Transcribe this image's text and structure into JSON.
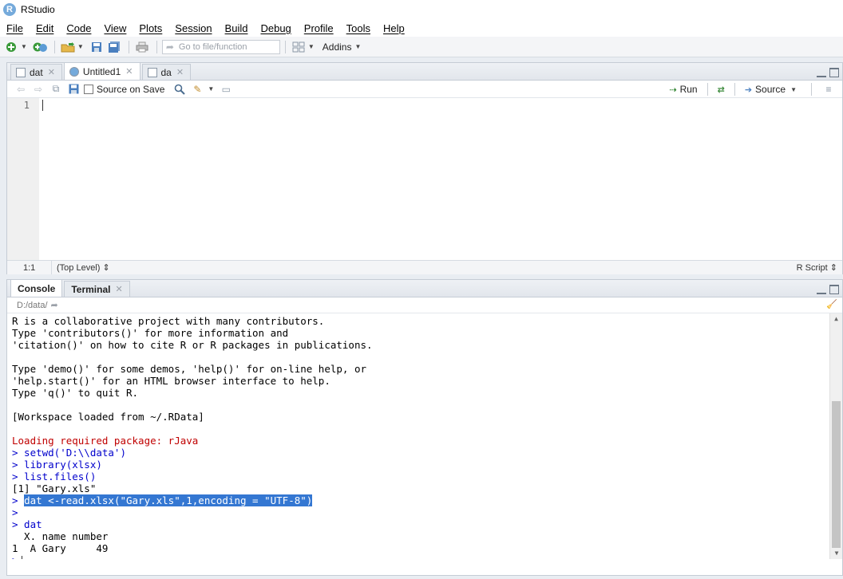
{
  "app": {
    "title": "RStudio",
    "logo": "R"
  },
  "menu": [
    "File",
    "Edit",
    "Code",
    "View",
    "Plots",
    "Session",
    "Build",
    "Debug",
    "Profile",
    "Tools",
    "Help"
  ],
  "toolbar": {
    "goto_placeholder": "Go to file/function",
    "addins_label": "Addins"
  },
  "source": {
    "tabs": [
      {
        "label": "dat",
        "active": false
      },
      {
        "label": "Untitled1",
        "active": true
      },
      {
        "label": "da",
        "active": false
      }
    ],
    "source_on_save": "Source on Save",
    "run_label": "Run",
    "source_label": "Source",
    "line_numbers": [
      "1"
    ],
    "cursor_pos": "1:1",
    "scope": "(Top Level) ⇕",
    "file_type": "R Script ⇕"
  },
  "console": {
    "tabs": [
      {
        "label": "Console",
        "active": true
      },
      {
        "label": "Terminal",
        "active": false
      }
    ],
    "path": "D:/data/",
    "lines": [
      {
        "kind": "out",
        "text": "R is a collaborative project with many contributors."
      },
      {
        "kind": "out",
        "text": "Type 'contributors()' for more information and"
      },
      {
        "kind": "out",
        "text": "'citation()' on how to cite R or R packages in publications."
      },
      {
        "kind": "out",
        "text": ""
      },
      {
        "kind": "out",
        "text": "Type 'demo()' for some demos, 'help()' for on-line help, or"
      },
      {
        "kind": "out",
        "text": "'help.start()' for an HTML browser interface to help."
      },
      {
        "kind": "out",
        "text": "Type 'q()' to quit R."
      },
      {
        "kind": "out",
        "text": ""
      },
      {
        "kind": "out",
        "text": "[Workspace loaded from ~/.RData]"
      },
      {
        "kind": "out",
        "text": ""
      },
      {
        "kind": "err",
        "text": "Loading required package: rJava"
      },
      {
        "kind": "cmd",
        "text": "> setwd('D:\\\\data')"
      },
      {
        "kind": "cmd",
        "text": "> library(xlsx)"
      },
      {
        "kind": "cmd",
        "text": "> list.files()"
      },
      {
        "kind": "out",
        "text": "[1] \"Gary.xls\""
      },
      {
        "kind": "cmd",
        "prompt": "> ",
        "text": "dat <-read.xlsx(\"Gary.xls\",1,encoding = \"UTF-8\")",
        "highlight": true
      },
      {
        "kind": "cmd",
        "text": ">"
      },
      {
        "kind": "cmd",
        "text": "> dat"
      },
      {
        "kind": "out",
        "text": "  X. name number"
      },
      {
        "kind": "out",
        "text": "1  A Gary     49"
      },
      {
        "kind": "cmd",
        "text": ">",
        "cursor": true
      }
    ]
  }
}
